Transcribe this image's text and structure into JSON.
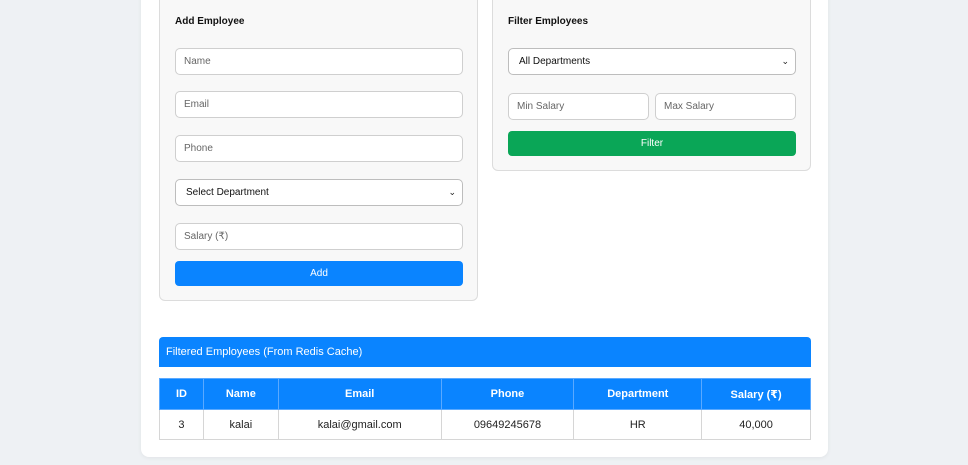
{
  "add_employee": {
    "title": "Add Employee",
    "name_placeholder": "Name",
    "email_placeholder": "Email",
    "phone_placeholder": "Phone",
    "department_select": "Select Department",
    "salary_placeholder": "Salary (₹)",
    "add_button": "Add"
  },
  "filter_employees": {
    "title": "Filter Employees",
    "department_select": "All Departments",
    "min_salary_placeholder": "Min Salary",
    "max_salary_placeholder": "Max Salary",
    "filter_button": "Filter"
  },
  "results": {
    "heading": "Filtered Employees (From Redis Cache)",
    "columns": [
      "ID",
      "Name",
      "Email",
      "Phone",
      "Department",
      "Salary (₹)"
    ],
    "rows": [
      [
        "3",
        "kalai",
        "kalai@gmail.com",
        "09649245678",
        "HR",
        "40,000"
      ]
    ]
  },
  "colors": {
    "primary": "#0a84ff",
    "success": "#0aa657",
    "page_bg": "#eef1f4"
  },
  "icons": {
    "select_chevron": "chevron-down-icon"
  }
}
